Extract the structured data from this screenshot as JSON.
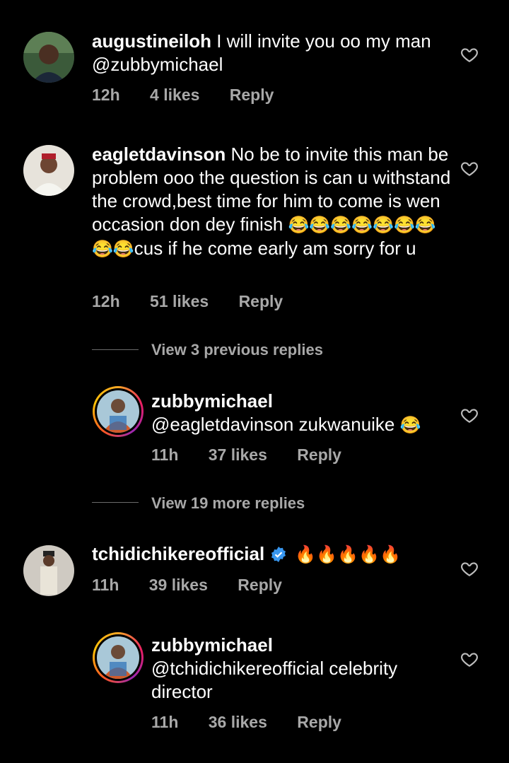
{
  "comments": [
    {
      "username": "augustineiloh",
      "text": "I will invite you oo my man @zubbymichael",
      "time": "12h",
      "likes": "4 likes",
      "reply": "Reply"
    },
    {
      "username": "eagletdavinson",
      "text_before": "No be to invite this man be problem ooo the question is can u withstand the crowd,best time for him to come is wen occasion don dey finish",
      "emojis": "😂😂😂😂😂😂😂😂😂",
      "text_after": "cus if he come early am sorry for u",
      "time": "12h",
      "likes": "51 likes",
      "reply": "Reply",
      "view_previous": "View 3 previous replies",
      "reply_item": {
        "username": "zubbymichael",
        "text": "@eagletdavinson zukwanuike",
        "emoji": "😂",
        "time": "11h",
        "likes": "37 likes",
        "reply": "Reply"
      },
      "view_more": "View 19 more replies"
    },
    {
      "username": "tchidichikereofficial",
      "fires": "🔥🔥🔥🔥🔥",
      "time": "11h",
      "likes": "39 likes",
      "reply": "Reply",
      "reply_item": {
        "username": "zubbymichael",
        "text": "@tchidichikereofficial celebrity director",
        "time": "11h",
        "likes": "36 likes",
        "reply": "Reply"
      }
    }
  ],
  "colors": {
    "background": "#000000",
    "text": "#ffffff",
    "meta": "#a8a8a8",
    "verified": "#3897f0"
  }
}
